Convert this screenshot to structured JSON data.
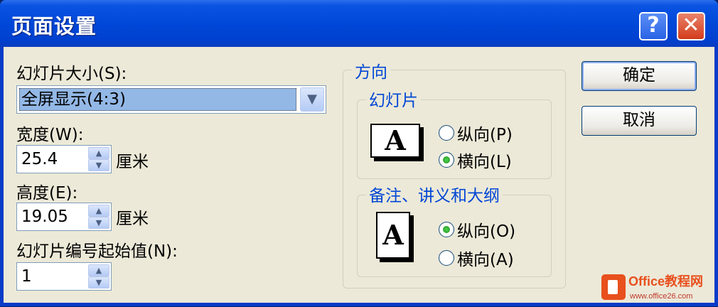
{
  "window": {
    "title": "页面设置",
    "help_glyph": "?",
    "close_glyph": "✕"
  },
  "slide_size": {
    "label": "幻灯片大小(S):",
    "value": "全屏显示(4:3)"
  },
  "width": {
    "label": "宽度(W):",
    "value": "25.4",
    "unit": "厘米"
  },
  "height": {
    "label": "高度(E):",
    "value": "19.05",
    "unit": "厘米"
  },
  "start_number": {
    "label": "幻灯片编号起始值(N):",
    "value": "1"
  },
  "orientation": {
    "title": "方向",
    "slides": {
      "title": "幻灯片",
      "icon_letter": "A",
      "portrait": "纵向(P)",
      "landscape": "横向(L)",
      "selected": "landscape"
    },
    "notes": {
      "title": "备注、讲义和大纲",
      "icon_letter": "A",
      "portrait": "纵向(O)",
      "landscape": "横向(A)",
      "selected": "portrait"
    }
  },
  "buttons": {
    "ok": "确定",
    "cancel": "取消"
  },
  "watermark": {
    "line1": "Office教程网",
    "line2": "www.office26.com"
  },
  "colors": {
    "title_bar": "#0048d8",
    "group_title": "#0046d5",
    "dialog_bg": "#ece9d8",
    "selection": "#93b8e6"
  },
  "icons": {
    "dropdown": "chevron-down-icon",
    "spin_up": "spin-up-icon",
    "spin_down": "spin-down-icon",
    "watermark": "office-logo-icon"
  }
}
